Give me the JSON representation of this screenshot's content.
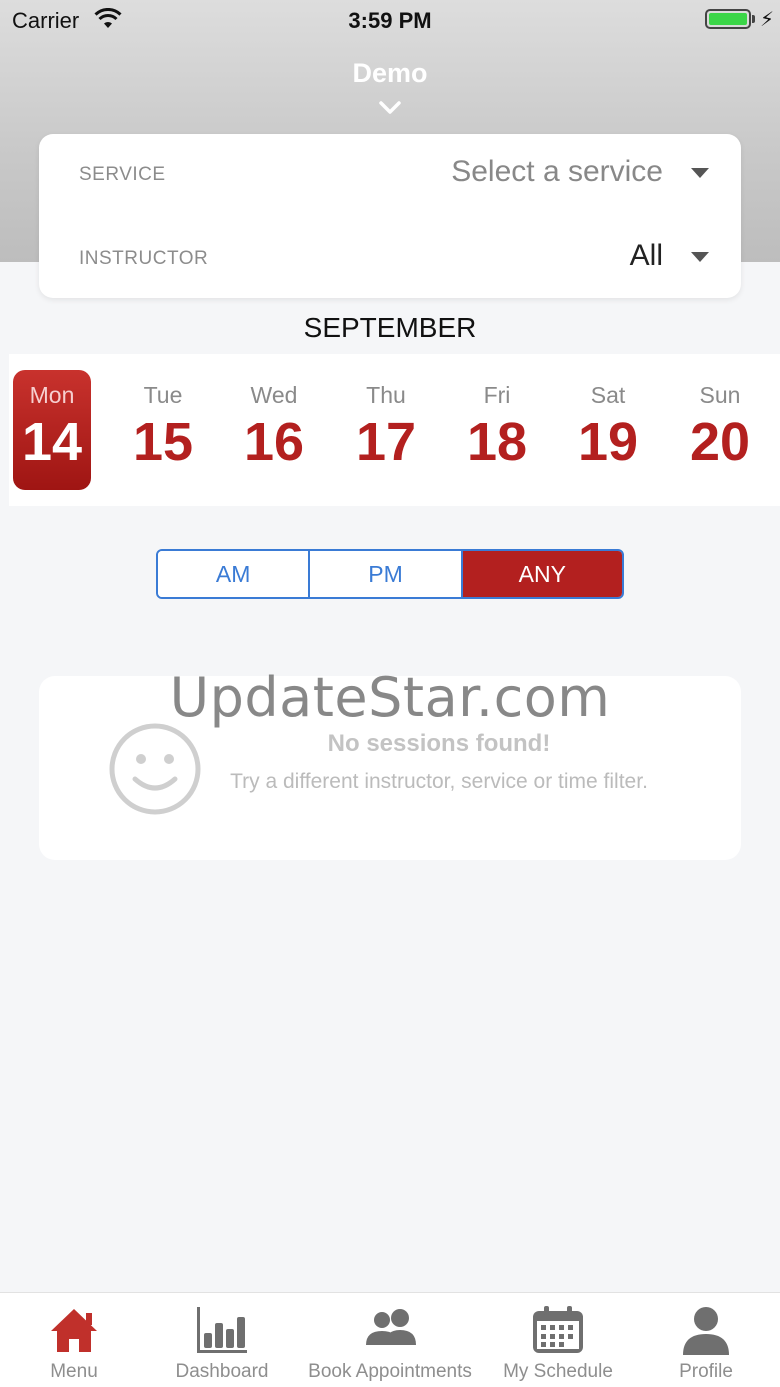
{
  "status_bar": {
    "carrier": "Carrier",
    "time": "3:59 PM"
  },
  "nav": {
    "title": "Demo"
  },
  "filters": {
    "service_label": "SERVICE",
    "service_value": "Select a service",
    "instructor_label": "INSTRUCTOR",
    "instructor_value": "All"
  },
  "calendar": {
    "month": "SEPTEMBER",
    "days": [
      {
        "name": "Mon",
        "num": "14",
        "selected": true
      },
      {
        "name": "Tue",
        "num": "15"
      },
      {
        "name": "Wed",
        "num": "16"
      },
      {
        "name": "Thu",
        "num": "17"
      },
      {
        "name": "Fri",
        "num": "18"
      },
      {
        "name": "Sat",
        "num": "19"
      },
      {
        "name": "Sun",
        "num": "20"
      }
    ]
  },
  "time_filter": {
    "am": "AM",
    "pm": "PM",
    "any": "ANY",
    "selected": "ANY"
  },
  "empty_state": {
    "title": "No sessions found!",
    "subtitle": "Try a different instructor, service or time filter."
  },
  "watermark": "UpdateStar.com",
  "tabs": [
    {
      "label": "Menu",
      "icon": "home-icon",
      "active": true
    },
    {
      "label": "Dashboard",
      "icon": "bar-chart-icon"
    },
    {
      "label": "Book Appointments",
      "icon": "people-icon"
    },
    {
      "label": "My Schedule",
      "icon": "calendar-icon"
    },
    {
      "label": "Profile",
      "icon": "person-icon"
    }
  ],
  "colors": {
    "accent": "#b3201f",
    "segment_blue": "#3a7bd5",
    "battery": "#3bd648"
  }
}
